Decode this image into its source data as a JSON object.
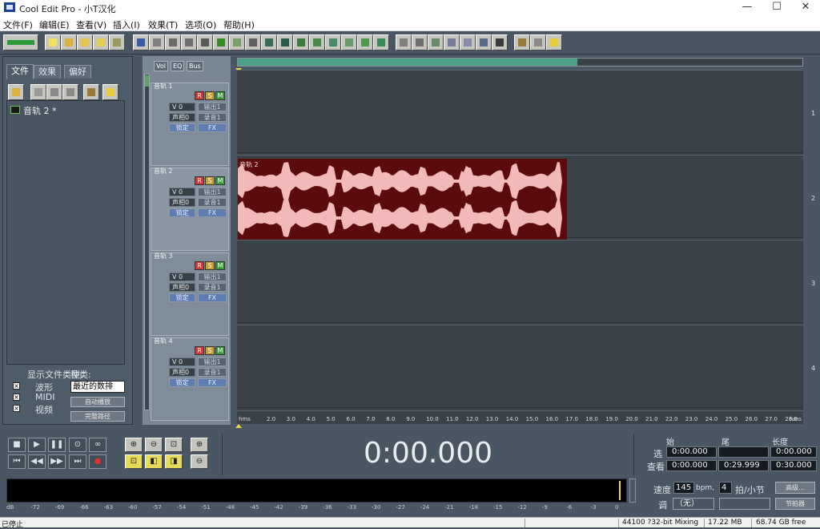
{
  "window": {
    "title": "Cool Edit Pro  - 小T汉化",
    "minimize": "—",
    "maximize": "☐",
    "close": "✕"
  },
  "menu": [
    "文件(F)",
    "编辑(E)",
    "查看(V)",
    "插入(I)",
    "效果(T)",
    "选项(O)",
    "帮助(H)"
  ],
  "left": {
    "tabs": [
      "文件",
      "效果",
      "偏好"
    ],
    "file_item": "音轨 2 *",
    "show_type_label": "显示文件类型:",
    "kind_label": "种类:",
    "types": [
      "波形",
      "MIDI",
      "视频"
    ],
    "kind_value": "最近的数排",
    "auto_play": "自动播放",
    "full_path": "完整路径"
  },
  "track_tabs": [
    "Vol",
    "EQ",
    "Bus"
  ],
  "tracks": [
    {
      "name": "音轨 1",
      "vol": "V 0",
      "pan": "声相0",
      "out": "输出1",
      "rec": "录音1",
      "lock": "锁定",
      "fx": "FX",
      "num": "1"
    },
    {
      "name": "音轨 2",
      "vol": "V 0",
      "pan": "声相0",
      "out": "输出1",
      "rec": "录音1",
      "lock": "锁定",
      "fx": "FX",
      "num": "2",
      "clip": "音轨 2"
    },
    {
      "name": "音轨 3",
      "vol": "V 0",
      "pan": "声相0",
      "out": "输出1",
      "rec": "录音1",
      "lock": "锁定",
      "fx": "FX",
      "num": "3"
    },
    {
      "name": "音轨 4",
      "vol": "V 0",
      "pan": "声相0",
      "out": "输出1",
      "rec": "录音1",
      "lock": "锁定",
      "fx": "FX",
      "num": "4"
    }
  ],
  "rsm": [
    "R",
    "S",
    "M"
  ],
  "ruler": [
    "hms",
    "2.0",
    "3.0",
    "4.0",
    "5.0",
    "6.0",
    "7.0",
    "8.0",
    "9.0",
    "10.0",
    "11.0",
    "12.0",
    "13.0",
    "14.0",
    "15.0",
    "16.0",
    "17.0",
    "18.0",
    "19.0",
    "20.0",
    "21.0",
    "22.0",
    "23.0",
    "24.0",
    "25.0",
    "26.0",
    "27.0",
    "28.0",
    "hms"
  ],
  "time": "0:00.000",
  "selection": {
    "start_label": "始",
    "end_label": "尾",
    "length_label": "长度",
    "sel_label": "选",
    "view_label": "查看",
    "sel_start": "0:00.000",
    "sel_end": "",
    "sel_length": "0:00.000",
    "view_start": "0:00.000",
    "view_end": "0:29.999",
    "view_length": "0:30.000"
  },
  "tempo": {
    "speed_label": "速度",
    "bpm": "145",
    "bpm_unit": "bpm,",
    "beats": "4",
    "beats_label": "拍/小节",
    "key_label": "调",
    "key": "（无）",
    "advanced": "高级...",
    "metronome": "节拍器"
  },
  "meter_ticks": [
    "dB",
    "-72",
    "-69",
    "-66",
    "-63",
    "-60",
    "-57",
    "-54",
    "-51",
    "-48",
    "-45",
    "-42",
    "-39",
    "-36",
    "-33",
    "-30",
    "-27",
    "-24",
    "-21",
    "-18",
    "-15",
    "-12",
    "-9",
    "-6",
    "-3",
    "0"
  ],
  "status": {
    "left": "已停止",
    "format": "44100 ?32-bit Mixing",
    "mem": "17.22 MB",
    "disk": "68.74 GB free"
  },
  "colors": {
    "clip_bg": "#5b0b0b",
    "wave": "#f2b9b9",
    "accent": "#4d9f87"
  }
}
